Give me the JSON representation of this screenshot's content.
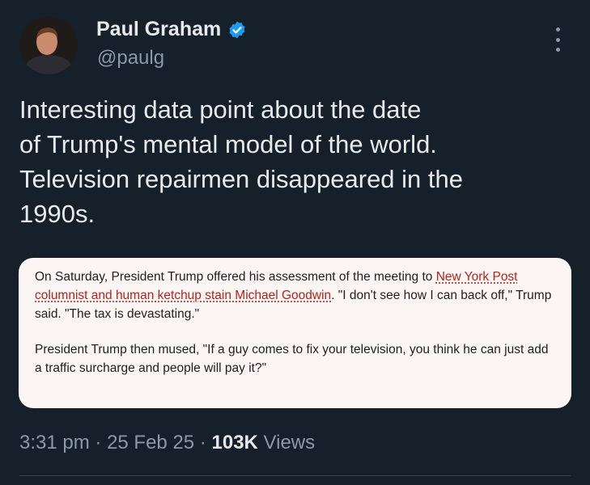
{
  "author": {
    "name": "Paul Graham",
    "handle": "@paulg",
    "verified_icon": "verified-badge-icon",
    "avatar_icon": "avatar-photo"
  },
  "tweet": {
    "lines": [
      "Interesting data point about the date",
      "of Trump's mental model of the world.",
      "Television repairmen disappeared in the",
      "1990s."
    ]
  },
  "quote": {
    "p1_before": "On Saturday, President Trump offered his assessment of the meeting to ",
    "p1_link": "New York Post columnist and human ketchup stain Michael Goodwin",
    "p1_after": ". \"I don't see how I can back off,\" Trump said. \"The tax is devastating.\"",
    "p2": "President Trump then mused, \"If a guy comes to fix your television, you think he can just add a traffic surcharge and people will pay it?\""
  },
  "meta": {
    "time": "3:31 pm",
    "date": "25 Feb 25",
    "views_count": "103K",
    "views_label": "Views",
    "separator": "·"
  },
  "colors": {
    "background": "#15202b",
    "text_primary": "#e7e9ea",
    "text_secondary": "#8b98a5",
    "verified": "#1d9bf0",
    "quote_bg": "#fbf6f4",
    "link": "#b3241b"
  }
}
